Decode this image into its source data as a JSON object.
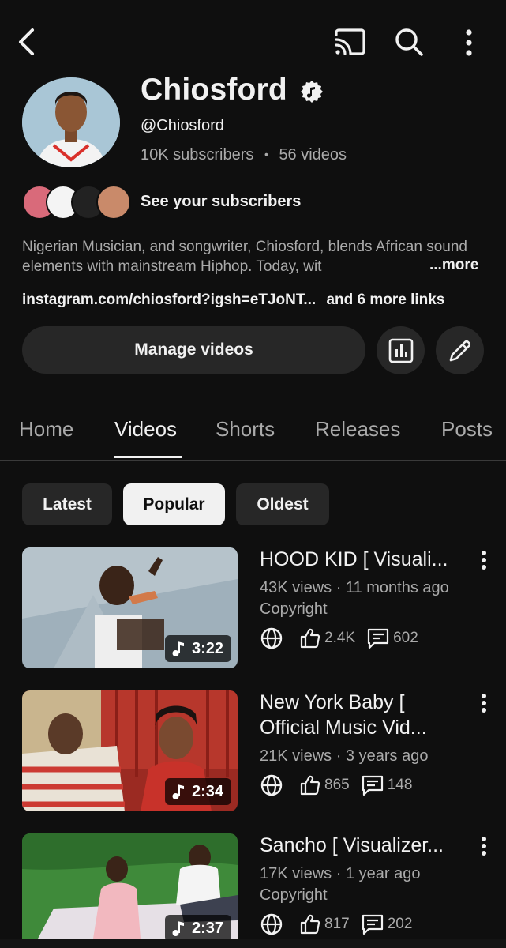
{
  "channel": {
    "name": "Chiosford",
    "handle": "@Chiosford",
    "subscribers": "10K subscribers",
    "separator": "•",
    "videos_count": "56 videos",
    "see_subscribers": "See your subscribers",
    "description": "Nigerian Musician, and songwriter, Chiosford, blends African sound elements with mainstream Hiphop. Today, wit",
    "description_more": "...more",
    "link": "instagram.com/chiosford?igsh=eTJoNT...",
    "more_links": "and 6 more links",
    "manage_videos": "Manage videos"
  },
  "tabs": [
    "Home",
    "Videos",
    "Shorts",
    "Releases",
    "Posts"
  ],
  "active_tab": "Videos",
  "chips": [
    "Latest",
    "Popular",
    "Oldest"
  ],
  "selected_chip": "Popular",
  "videos": [
    {
      "title": "HOOD KID [ Visuali...",
      "meta": "43K views · 11 months ago",
      "extra": "Copyright",
      "duration": "3:22",
      "likes": "2.4K",
      "comments": "602"
    },
    {
      "title": "New York Baby [ Official Music Vid...",
      "meta": "21K views · 3 years ago",
      "extra": "",
      "duration": "2:34",
      "likes": "865",
      "comments": "148"
    },
    {
      "title": "Sancho [ Visualizer...",
      "meta": "17K views · 1 year ago",
      "extra": "Copyright",
      "duration": "2:37",
      "likes": "817",
      "comments": "202"
    }
  ],
  "colors": {
    "background": "#0f0f0f",
    "surface": "#272727",
    "text_primary": "#f1f1f1",
    "text_secondary": "#aaaaaa"
  },
  "icons": [
    "back-arrow-icon",
    "cast-icon",
    "search-icon",
    "more-vert-icon",
    "verified-music-icon",
    "analytics-icon",
    "edit-pencil-icon",
    "globe-icon",
    "thumbs-up-icon",
    "comment-icon",
    "music-note-icon"
  ]
}
